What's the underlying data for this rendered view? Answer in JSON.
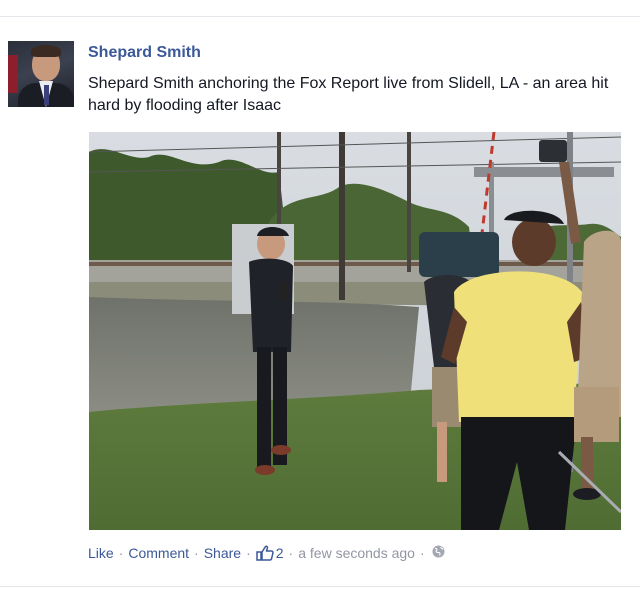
{
  "post": {
    "author": "Shepard Smith",
    "message": "Shepard Smith anchoring the Fox Report live from Slidell, LA - an area hit hard by flooding after Isaac",
    "photo_icon": "flood-report-photo"
  },
  "actions": {
    "like": "Like",
    "comment": "Comment",
    "share": "Share",
    "like_count": "2",
    "timestamp": "a few seconds ago",
    "separator": "·"
  },
  "icons": {
    "like_count": "thumbs-up-icon",
    "audience": "globe-icon"
  },
  "colors": {
    "link": "#3b5998",
    "meta": "#9197a3",
    "text": "#141823"
  }
}
